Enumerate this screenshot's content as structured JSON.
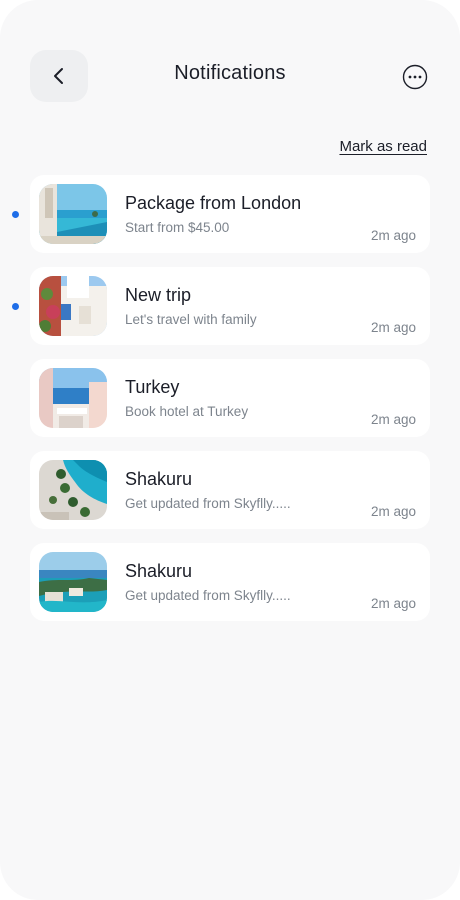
{
  "header": {
    "title": "Notifications",
    "back_icon": "chevron-left-icon",
    "more_icon": "more-horizontal-icon"
  },
  "actions": {
    "mark_as_read": "Mark as read"
  },
  "notifications": [
    {
      "title": "Package from London",
      "subtitle": "Start from $45.00",
      "time": "2m ago",
      "unread": true,
      "thumbnail": "pool-sea-photo"
    },
    {
      "title": "New trip",
      "subtitle": "Let's travel with family",
      "time": "2m ago",
      "unread": true,
      "thumbnail": "white-village-photo"
    },
    {
      "title": "Turkey",
      "subtitle": "Book hotel at Turkey",
      "time": "2m ago",
      "unread": false,
      "thumbnail": "coastal-terrace-photo"
    },
    {
      "title": "Shakuru",
      "subtitle": "Get updated from Skyflly.....",
      "time": "2m ago",
      "unread": false,
      "thumbnail": "aerial-pool-photo"
    },
    {
      "title": "Shakuru",
      "subtitle": "Get updated from Skyflly.....",
      "time": "2m ago",
      "unread": false,
      "thumbnail": "island-resort-photo"
    }
  ],
  "colors": {
    "background": "#f8f8f9",
    "card": "#ffffff",
    "text_primary": "#1b1e28",
    "text_secondary": "#7d848d",
    "unread_dot": "#1f6ee8"
  }
}
